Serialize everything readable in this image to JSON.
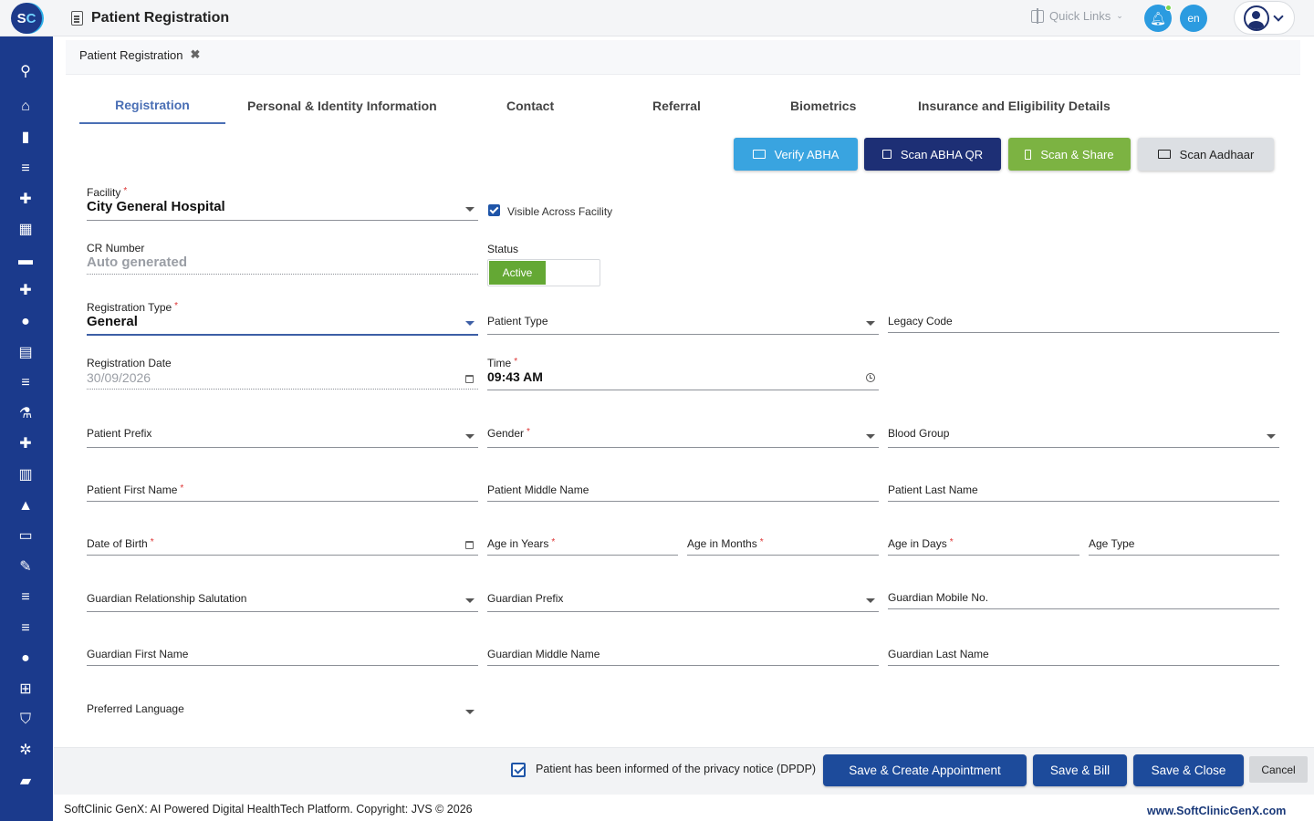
{
  "app": {
    "logo_s": "S",
    "logo_c": "C",
    "title": "Patient Registration",
    "quick_links": "Quick Links",
    "lang": "en"
  },
  "breadcrumb": {
    "tab_label": "Patient Registration"
  },
  "tabs": [
    {
      "label": "Registration"
    },
    {
      "label": "Personal & Identity Information"
    },
    {
      "label": "Contact"
    },
    {
      "label": "Referral"
    },
    {
      "label": "Biometrics"
    },
    {
      "label": "Insurance and Eligibility Details"
    }
  ],
  "actions": {
    "verify_abha": "Verify ABHA",
    "scan_abha_qr": "Scan ABHA QR",
    "scan_share": "Scan & Share",
    "scan_aadhaar": "Scan Aadhaar"
  },
  "colors": {
    "sidebar": "#1b3a8c",
    "verify_abha": "#39a4e0",
    "scan_abha_qr": "#1d2f75",
    "scan_share": "#7cb342",
    "scan_aadhaar": "#dcdfe3",
    "status_active": "#64a834",
    "primary_button": "#1d4b9b"
  },
  "form": {
    "facility": {
      "label": "Facility",
      "value": "City General Hospital"
    },
    "visible_across": {
      "label": "Visible Across Facility",
      "checked": true
    },
    "cr_number": {
      "label": "CR Number",
      "value": "Auto generated"
    },
    "status": {
      "label": "Status",
      "value": "Active"
    },
    "registration_type": {
      "label": "Registration Type",
      "value": "General"
    },
    "patient_type": {
      "label": "Patient Type"
    },
    "legacy_code": {
      "label": "Legacy Code"
    },
    "registration_date": {
      "label": "Registration Date",
      "value": "30/09/2026"
    },
    "time": {
      "label": "Time",
      "value": "09:43 AM"
    },
    "patient_prefix": {
      "label": "Patient Prefix"
    },
    "gender": {
      "label": "Gender"
    },
    "blood_group": {
      "label": "Blood Group"
    },
    "first_name": {
      "label": "Patient First Name"
    },
    "middle_name": {
      "label": "Patient Middle Name"
    },
    "last_name": {
      "label": "Patient Last Name"
    },
    "dob": {
      "label": "Date of Birth"
    },
    "age_years": {
      "label": "Age in Years"
    },
    "age_months": {
      "label": "Age in Months"
    },
    "age_days": {
      "label": "Age in Days"
    },
    "age_type": {
      "label": "Age Type"
    },
    "guardian_salutation": {
      "label": "Guardian Relationship Salutation"
    },
    "guardian_prefix": {
      "label": "Guardian Prefix"
    },
    "guardian_mobile": {
      "label": "Guardian Mobile No."
    },
    "guardian_first": {
      "label": "Guardian First Name"
    },
    "guardian_middle": {
      "label": "Guardian Middle Name"
    },
    "guardian_last": {
      "label": "Guardian Last Name"
    },
    "preferred_language": {
      "label": "Preferred Language"
    }
  },
  "footer": {
    "dpdp_label": "Patient has been informed of the privacy notice (DPDP)",
    "save_appointment": "Save & Create Appointment",
    "save_bill": "Save & Bill",
    "save_close": "Save & Close",
    "cancel": "Cancel",
    "copyright": "SoftClinic GenX: AI Powered Digital HealthTech Platform. Copyright: JVS © 2026",
    "website": "www.SoftClinicGenX.com"
  }
}
